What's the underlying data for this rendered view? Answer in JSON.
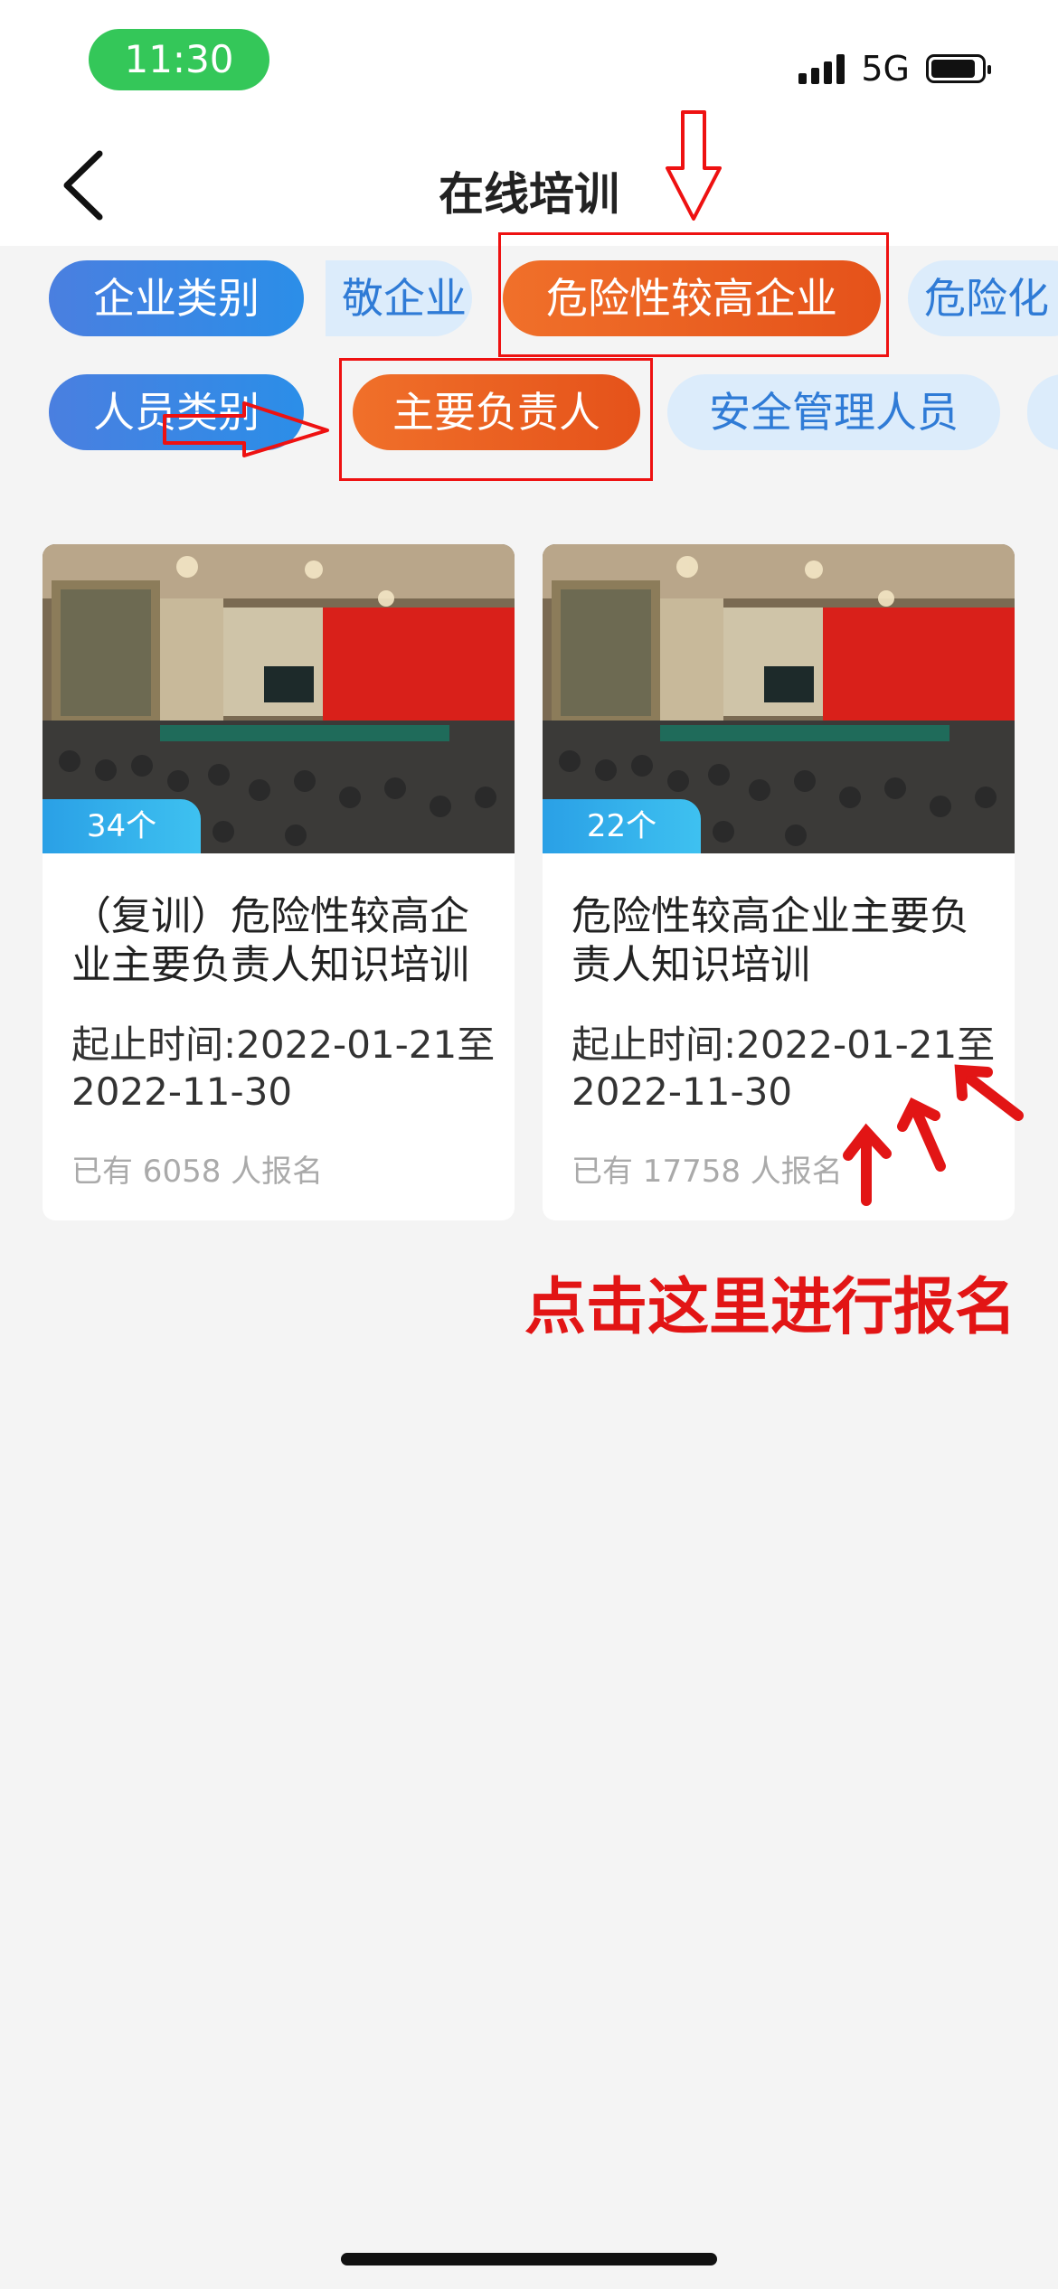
{
  "status_bar": {
    "time": "11:30",
    "network": "5G",
    "icons": [
      "signal-icon",
      "battery-icon"
    ]
  },
  "nav": {
    "back_icon": "chevron-left-icon",
    "title": "在线培训"
  },
  "filters": {
    "company_label": "企业类别",
    "company_options": [
      "敬企业",
      "危险性较高企业",
      "危险化"
    ],
    "company_selected": "危险性较高企业",
    "person_label": "人员类别",
    "person_options": [
      "主要负责人",
      "安全管理人员"
    ],
    "person_selected": "主要负责人"
  },
  "courses": [
    {
      "count_badge": "34个",
      "title": "（复训）危险性较高企业主要负责人知识培训",
      "date_line": "起止时间:2022-01-21至 2022-11-30",
      "enrolled": "已有 6058 人报名"
    },
    {
      "count_badge": "22个",
      "title": "危险性较高企业主要负责人知识培训",
      "date_line": "起止时间:2022-01-21至 2022-11-30",
      "enrolled": "已有 17758 人报名"
    }
  ],
  "annotation": {
    "cta_text": "点击这里进行报名",
    "color": "#e21515"
  },
  "colors": {
    "accent_blue": "#2b8ee8",
    "active_orange": "#e5521a",
    "chip_bg": "#dcecfb"
  }
}
